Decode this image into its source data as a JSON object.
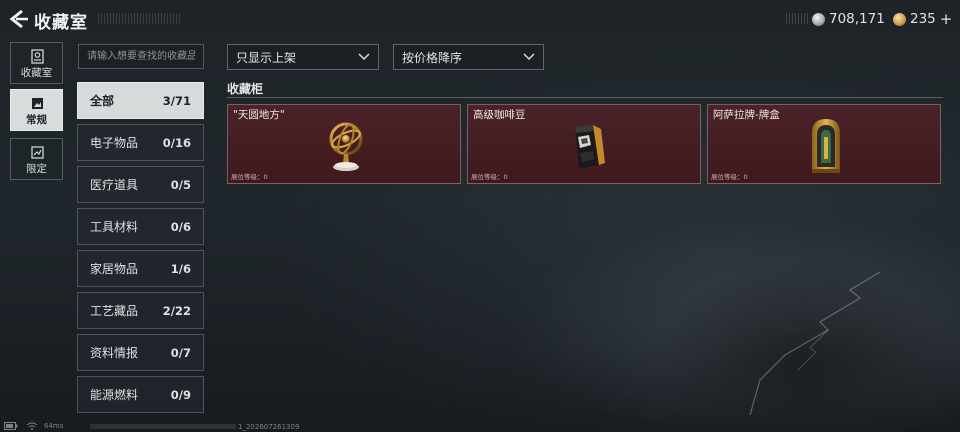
{
  "header": {
    "title": "收藏室",
    "silver_balance": "708,171",
    "gold_balance": "235",
    "plus_label": "+"
  },
  "rail": [
    {
      "label": "收藏室",
      "icon": "collection-room-icon"
    },
    {
      "label": "常规",
      "icon": "regular-icon",
      "active": true
    },
    {
      "label": "限定",
      "icon": "limited-icon"
    }
  ],
  "search": {
    "placeholder": "请输入想要查找的收藏品"
  },
  "filters": {
    "shelf": "只显示上架",
    "sort": "按价格降序"
  },
  "categories": [
    {
      "label": "全部",
      "count": "3/71",
      "active": true
    },
    {
      "label": "电子物品",
      "count": "0/16"
    },
    {
      "label": "医疗道具",
      "count": "0/5"
    },
    {
      "label": "工具材料",
      "count": "0/6"
    },
    {
      "label": "家居物品",
      "count": "1/6"
    },
    {
      "label": "工艺藏品",
      "count": "2/22"
    },
    {
      "label": "资料情报",
      "count": "0/7"
    },
    {
      "label": "能源燃料",
      "count": "0/9"
    }
  ],
  "cabinet": {
    "title": "收藏柜",
    "items": [
      {
        "name": "\"天圆地方\"",
        "level": "展位等级：0",
        "icon": "armillary-sphere-icon"
      },
      {
        "name": "高级咖啡豆",
        "level": "展位等级：0",
        "icon": "coffee-bag-icon"
      },
      {
        "name": "阿萨拉牌-牌盒",
        "level": "展位等级：0",
        "icon": "card-box-icon"
      }
    ]
  },
  "status": {
    "ping": "64ms",
    "build": "1_202607261309"
  },
  "colors": {
    "card_bg": "#451d23",
    "active_tab": "#d7dadb",
    "background": "#1d2327"
  }
}
